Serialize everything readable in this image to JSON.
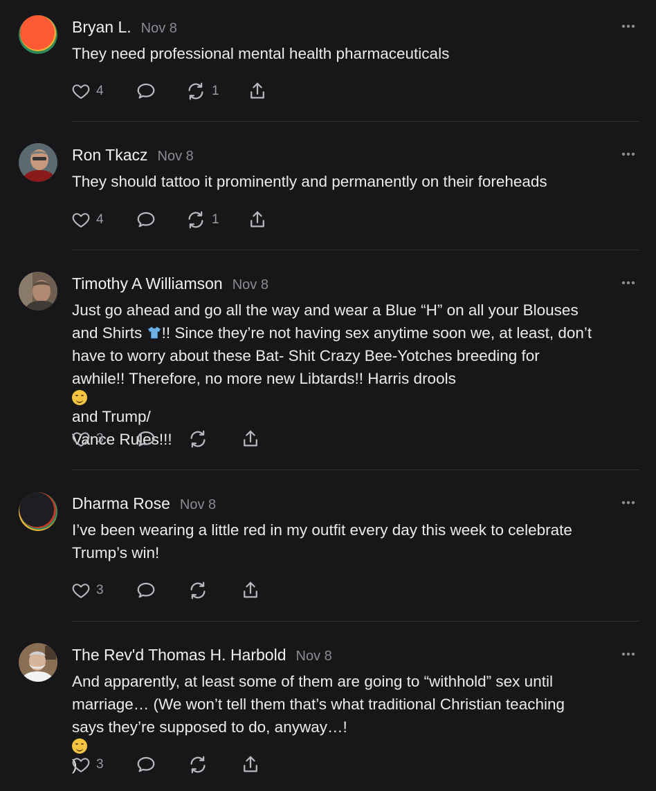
{
  "colors": {
    "background": "#17171a",
    "divider": "#2f2f33",
    "text": "#ececec",
    "muted": "#8b8b90"
  },
  "comments": [
    {
      "author": "Bryan L.",
      "date": "Nov 8",
      "avatar_icon": "orange-gradient-avatar",
      "lines": [
        "They need professional mental health pharmaceuticals"
      ],
      "likes": "4",
      "restacks": "1"
    },
    {
      "author": "Ron Tkacz",
      "date": "Nov 8",
      "avatar_icon": "photo-avatar",
      "lines": [
        "They should tattoo it prominently and permanently on their foreheads"
      ],
      "likes": "4",
      "restacks": "1"
    },
    {
      "author": "Timothy A Williamson",
      "date": "Nov 8",
      "avatar_icon": "photo-avatar",
      "lines": [
        "Just go ahead and go all the way and wear a Blue “H” on all your Blouses",
        "and Shirts ",
        "!! Since they’re not having sex anytime soon we, at least, don’t",
        "have to worry about these Bat- Shit Crazy Bee-Yotches breeding for",
        "awhile!! Therefore, no more new Libtards!! Harris drools ",
        " and Trump/",
        "Vance Rules!!!"
      ],
      "likes": "3",
      "restacks": ""
    },
    {
      "author": "Dharma Rose",
      "date": "Nov 8",
      "avatar_icon": "dark-gradient-avatar",
      "lines": [
        "I’ve been wearing a little red in my outfit every day this week to celebrate",
        "Trump’s win!"
      ],
      "likes": "3",
      "restacks": ""
    },
    {
      "author": "The Rev'd Thomas H. Harbold",
      "date": "Nov 8",
      "avatar_icon": "photo-avatar",
      "lines": [
        "And apparently, at least some of them are going to “withhold” sex until",
        "marriage… (We won’t tell them that’s what traditional Christian teaching",
        "says they’re supposed to do, anyway…! ",
        ")"
      ],
      "likes": "3",
      "restacks": ""
    }
  ]
}
